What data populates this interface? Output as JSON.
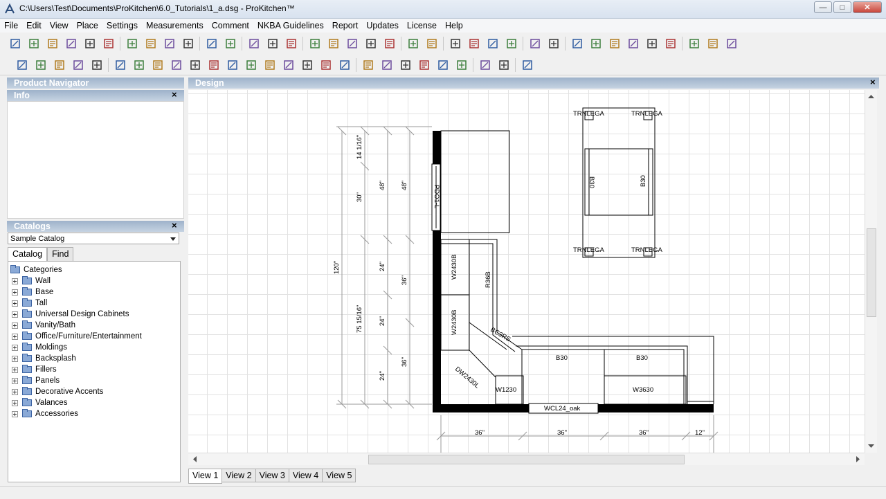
{
  "window": {
    "title": "C:\\Users\\Test\\Documents\\ProKitchen\\6.0_Tutorials\\1_a.dsg - ProKitchen™",
    "minimize": "—",
    "maximize": "□",
    "close": "✕"
  },
  "menu": [
    "File",
    "Edit",
    "View",
    "Place",
    "Settings",
    "Measurements",
    "Comment",
    "NKBA Guidelines",
    "Report",
    "Updates",
    "License",
    "Help"
  ],
  "toolbar1": [
    "new-icon",
    "open-icon",
    "open-recent-icon",
    "open-folder-icon",
    "save-icon",
    "info-icon",
    "sep",
    "copy-icon",
    "cut-icon",
    "paste-icon",
    "delete-icon",
    "sep",
    "undo-icon",
    "redo-icon",
    "sep",
    "print-icon",
    "print-preview-icon",
    "print-setup-icon",
    "sep",
    "select-arrow-icon",
    "pan-hand-icon",
    "zoom-in-icon",
    "zoom-window-icon",
    "zoom-extents-icon",
    "sep",
    "group-icon",
    "layout-icon",
    "sep",
    "grid-icon",
    "elevation-icon",
    "catalog-book-icon",
    "door-icon",
    "sep",
    "view-3d-icon",
    "render-icon",
    "sep",
    "settings-icon",
    "pricing-icon",
    "report-icon",
    "export-icon",
    "color-icon",
    "rulers-icon",
    "sep",
    "layers-icon",
    "help-book-icon",
    "door-style-icon"
  ],
  "toolbar2": [
    "pencil-wall-icon",
    "pencil-icon",
    "u-shape-icon",
    "l-shape-icon",
    "square-room-icon",
    "sep",
    "door-open-icon",
    "window-icon",
    "cabinet-door-icon",
    "appliance-icon",
    "faucet-icon",
    "sink-icon",
    "table-icon",
    "vase-icon",
    "box-icon",
    "molding-icon",
    "pattern-icon",
    "countertop-icon",
    "tray-icon",
    "sep",
    "dimension-horizontal-icon",
    "dimension-vertical-icon",
    "dimension-angle-icon",
    "dimension-diagonal-icon",
    "height-icon",
    "elevation-mark-icon",
    "sep",
    "flip-icon",
    "pointer-cursor-icon",
    "sep",
    "export-image-icon"
  ],
  "left": {
    "product_navigator": "Product Navigator",
    "info": "Info",
    "info_close": "×",
    "catalogs": "Catalogs",
    "catalogs_close": "×",
    "catalog_selected": "Sample Catalog",
    "tab_catalog": "Catalog",
    "tab_find": "Find",
    "root": "Categories",
    "categories": [
      "Wall",
      "Base",
      "Tall",
      "Universal Design Cabinets",
      "Vanity/Bath",
      "Office/Furniture/Entertainment",
      "Moldings",
      "Backsplash",
      "Fillers",
      "Panels",
      "Decorative Accents",
      "Valances",
      "Accessories"
    ]
  },
  "design": {
    "title": "Design",
    "close": "×",
    "labels": {
      "trnlega": "TRNLEGA",
      "b30": "B30",
      "pdo1": "PDO1-L",
      "w2430b": "W2430B",
      "r36b": "R36B",
      "bc": "BC3RS",
      "dw": "DW2430L",
      "w1230": "W1230",
      "w3630": "W3630",
      "wcl": "WCL24_oak"
    },
    "dims": {
      "d120": "120\"",
      "d75": "75 15/16\"",
      "d30": "30\"",
      "d14": "14 1/16\"",
      "d48": "48\"",
      "d24": "24\"",
      "d36": "36\"",
      "d12": "12\""
    }
  },
  "view_tabs": [
    "View 1",
    "View 2",
    "View 3",
    "View 4",
    "View 5"
  ]
}
